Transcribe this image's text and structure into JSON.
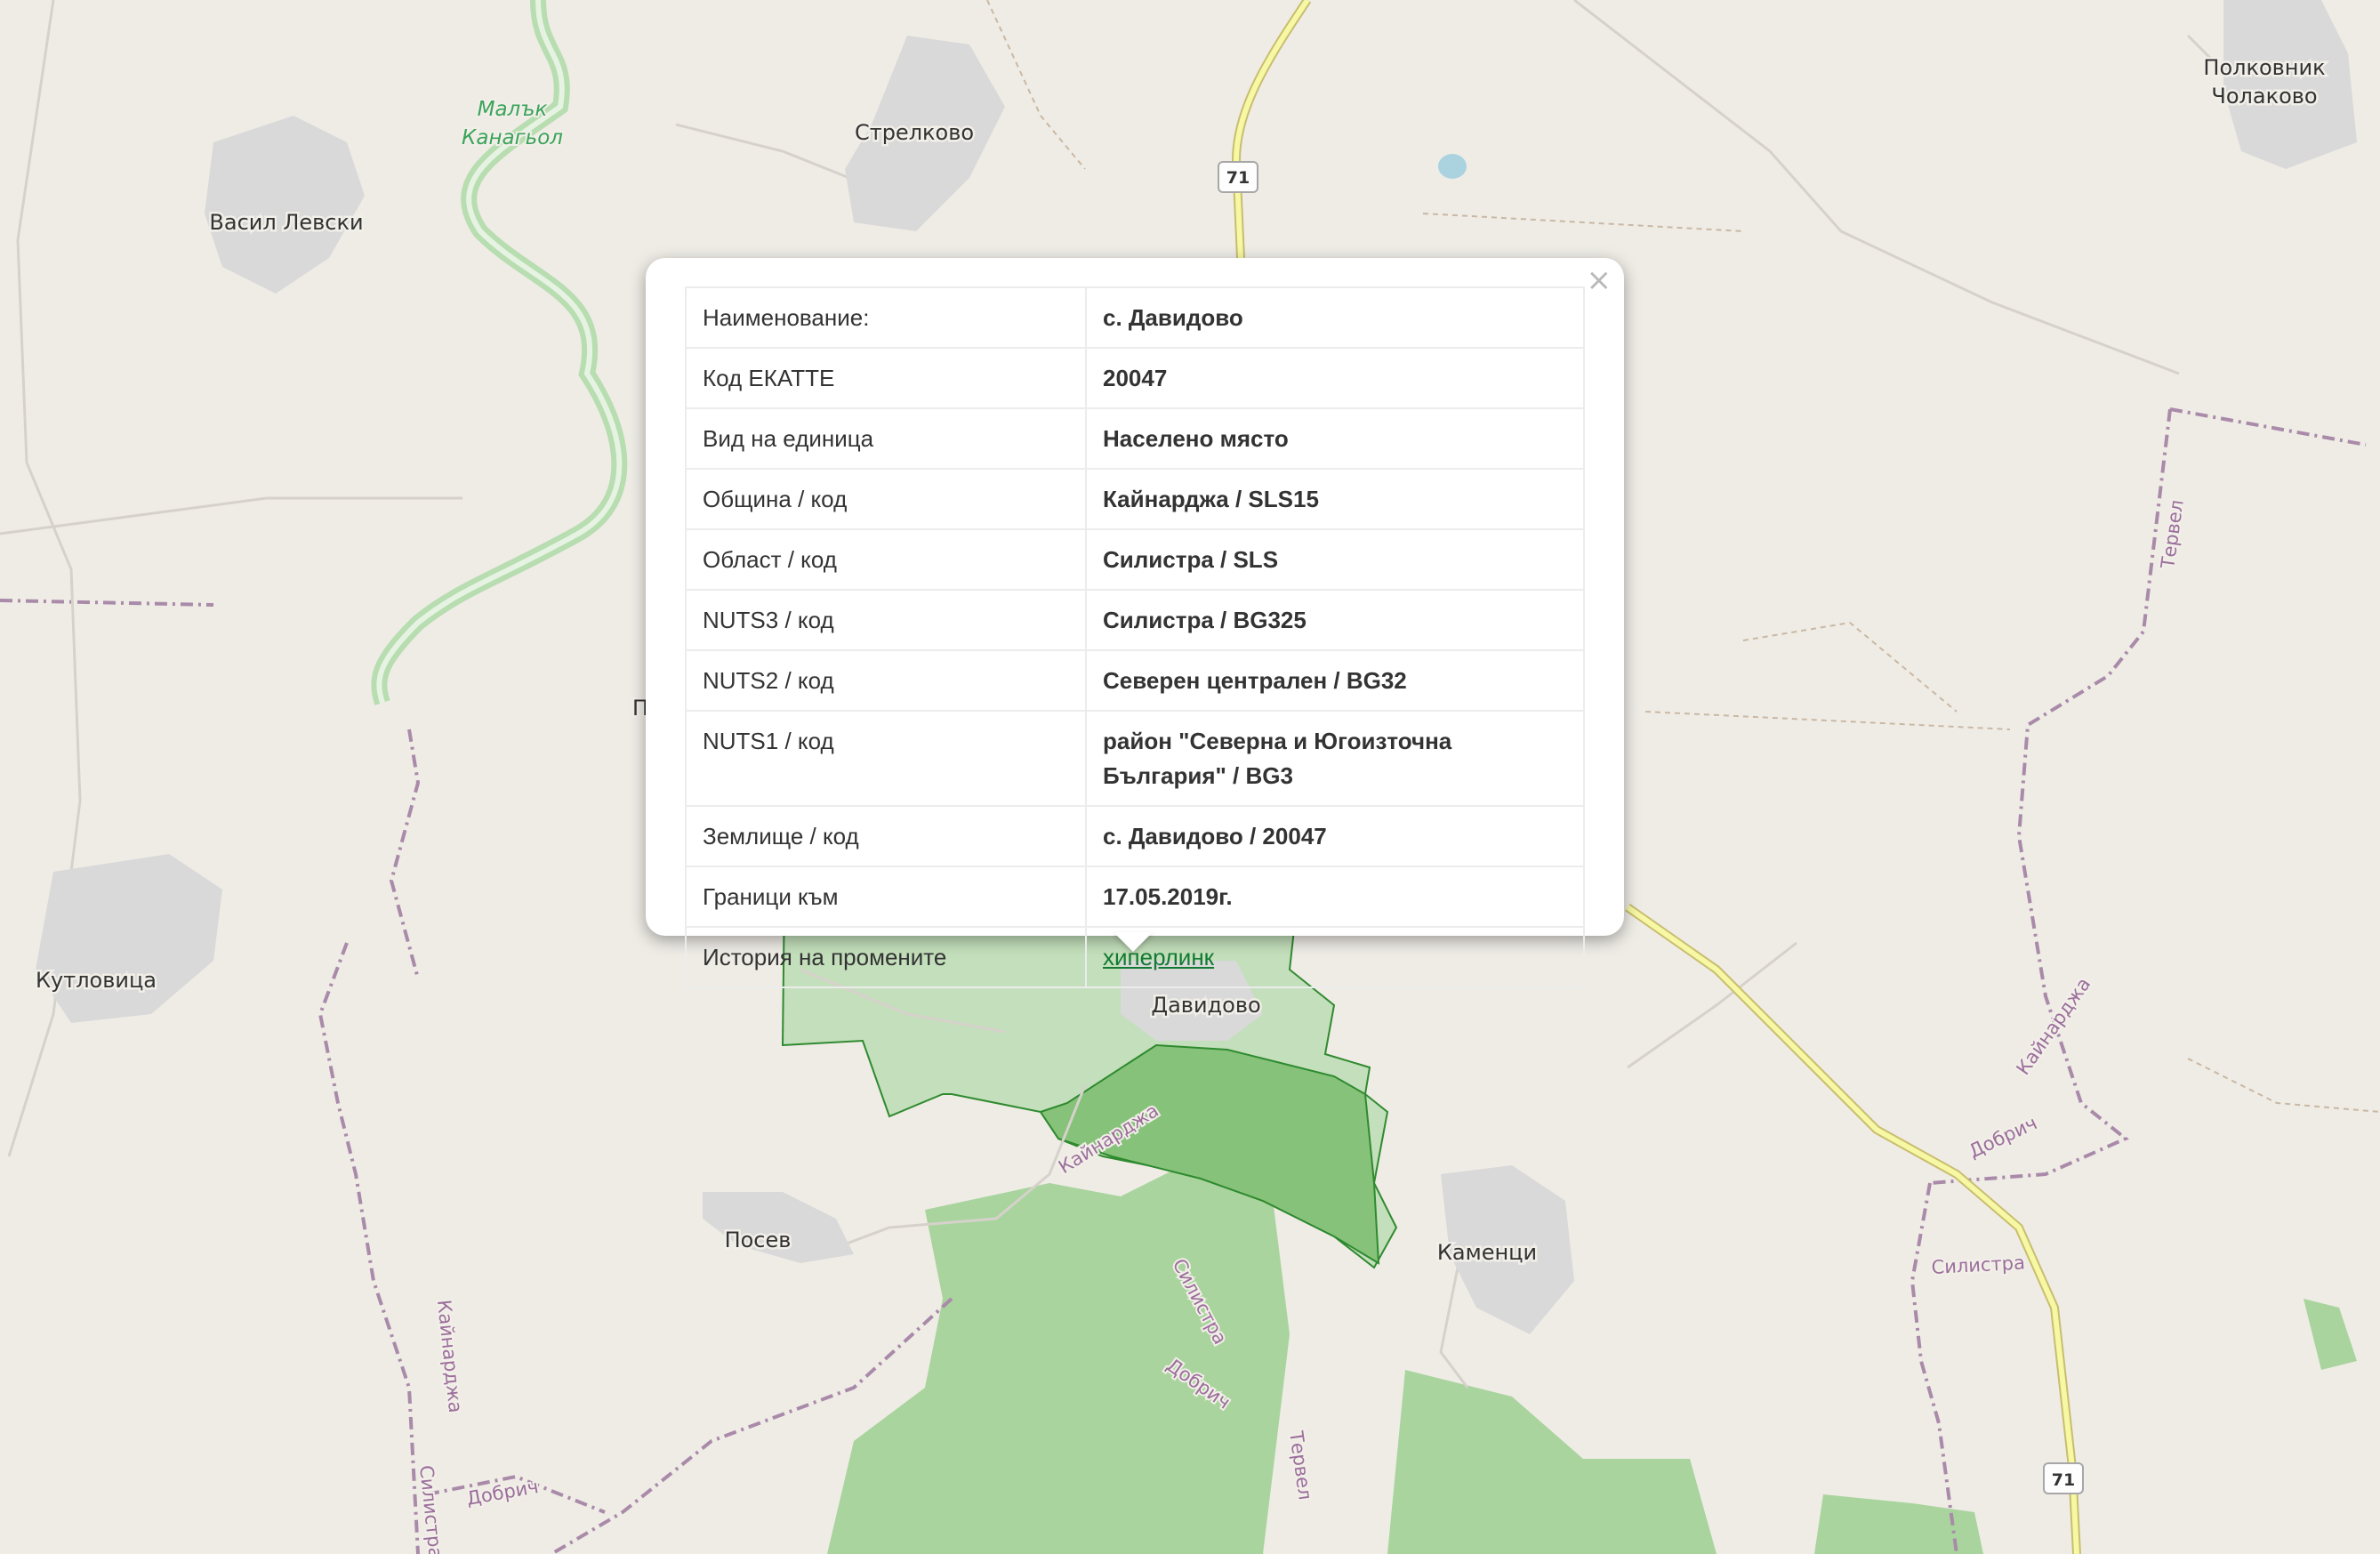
{
  "map": {
    "places": [
      {
        "name": "Полковник",
        "id": "polkovnik"
      },
      {
        "name": "Чолаково",
        "id": "cholakovo"
      },
      {
        "name": "Стрелково",
        "id": "strelkovo"
      },
      {
        "name": "Васил Левски",
        "id": "vasil-levski"
      },
      {
        "name": "Кутловица",
        "id": "kutlovica"
      },
      {
        "name": "Давидово",
        "id": "davidovo"
      },
      {
        "name": "Посев",
        "id": "posev"
      },
      {
        "name": "Каменци",
        "id": "kamenci"
      },
      {
        "name": "П",
        "id": "p-cut"
      }
    ],
    "river": [
      "Малък",
      "Канагьол"
    ],
    "borders": [
      "Тервел",
      "Кайнарджа",
      "Добрич",
      "Силистра",
      "Кайнарджа",
      "Силистра",
      "Добрич",
      "Тервел",
      "Кайнарджа",
      "Добрич",
      "Силистра"
    ],
    "road_shields": [
      "71",
      "71"
    ],
    "colors": {
      "background": "#efece6",
      "forest": "#a9d49e",
      "selected_area": "#c3dfbb",
      "selected_border": "#2f8a2f",
      "admin_border": "#a98aa9",
      "road_major": "#f6f8a4",
      "settlement": "#d9d9d9",
      "link": "#127a32"
    }
  },
  "popup": {
    "close_symbol": "×",
    "rows": [
      {
        "key": "Наименование:",
        "value": "с. Давидово"
      },
      {
        "key": "Код ЕКАТТЕ",
        "value": "20047"
      },
      {
        "key": "Вид на единица",
        "value": "Населено място"
      },
      {
        "key": "Община / код",
        "value": "Кайнарджа / SLS15"
      },
      {
        "key": "Област / код",
        "value": "Силистра / SLS"
      },
      {
        "key": "NUTS3 / код",
        "value": "Силистра / BG325"
      },
      {
        "key": "NUTS2 / код",
        "value": "Северен централен / BG32"
      },
      {
        "key": "NUTS1 / код",
        "value_line1": "район \"Северна и Югоизточна",
        "value_line2": "България\" / BG3"
      },
      {
        "key": "Землище / код",
        "value": "с. Давидово / 20047"
      },
      {
        "key": "Граници към",
        "value": "17.05.2019г."
      },
      {
        "key": "История на промените",
        "link": "хиперлинк"
      }
    ]
  }
}
